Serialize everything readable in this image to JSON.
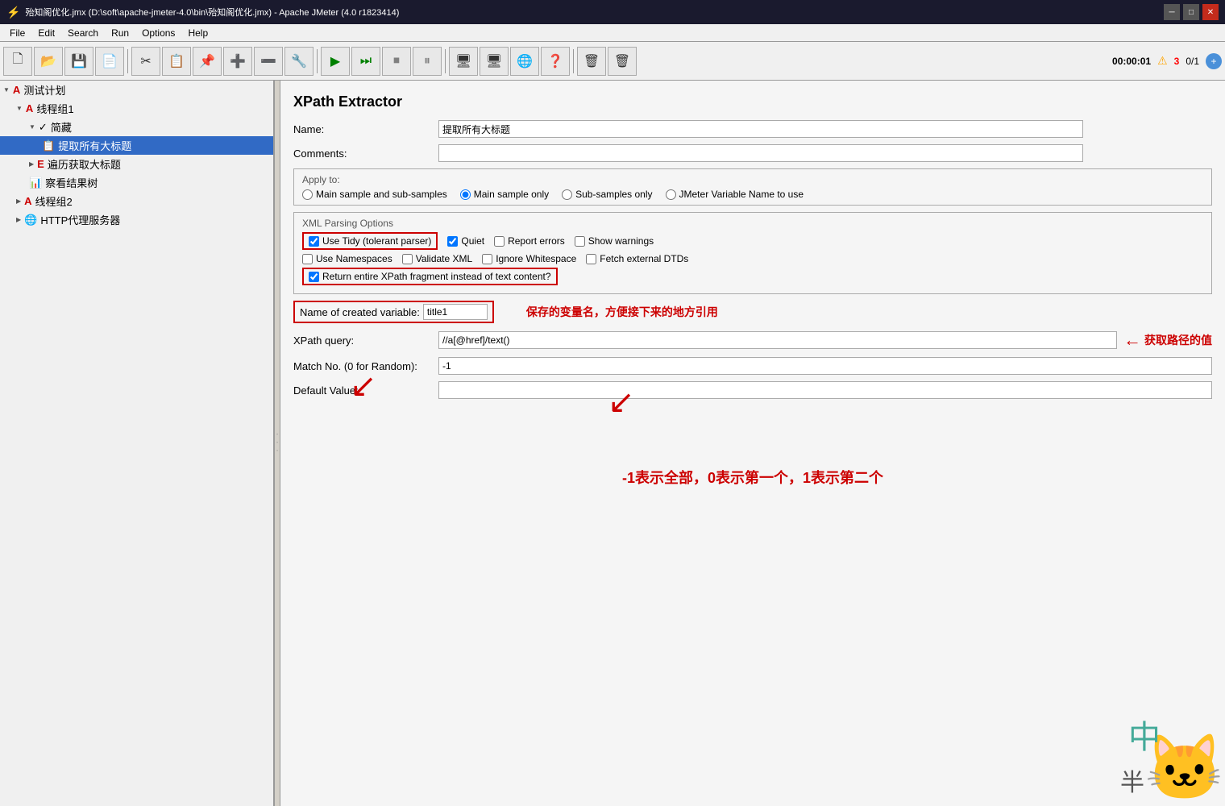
{
  "window": {
    "title": "殆知阁优化.jmx (D:\\soft\\apache-jmeter-4.0\\bin\\殆知阁优化.jmx) - Apache JMeter (4.0 r1823414)",
    "icon": "⚡"
  },
  "title_bar": {
    "minimize": "─",
    "maximize": "□",
    "close": "✕"
  },
  "menu": {
    "items": [
      "File",
      "Edit",
      "Search",
      "Run",
      "Options",
      "Help"
    ]
  },
  "toolbar": {
    "timer": "00:00:01",
    "count": "0/1"
  },
  "sidebar": {
    "items": [
      {
        "id": "test-plan",
        "label": "测试计划",
        "level": 0,
        "icon": "🔧",
        "expand": true,
        "selected": false
      },
      {
        "id": "thread-group1",
        "label": "线程组1",
        "level": 1,
        "icon": "⚙",
        "expand": true,
        "selected": false
      },
      {
        "id": "collection",
        "label": "简藏",
        "level": 2,
        "icon": "📁",
        "expand": true,
        "selected": false
      },
      {
        "id": "extract-title",
        "label": "提取所有大标题",
        "level": 3,
        "icon": "📋",
        "expand": false,
        "selected": true
      },
      {
        "id": "traverse-get",
        "label": "遍历获取大标题",
        "level": 2,
        "icon": "🔄",
        "expand": false,
        "selected": false
      },
      {
        "id": "view-result",
        "label": "察看结果树",
        "level": 2,
        "icon": "📊",
        "expand": false,
        "selected": false
      },
      {
        "id": "thread-group2",
        "label": "线程组2",
        "level": 1,
        "icon": "⚙",
        "expand": false,
        "selected": false
      },
      {
        "id": "http-proxy",
        "label": "HTTP代理服务器",
        "level": 1,
        "icon": "🌐",
        "expand": false,
        "selected": false
      }
    ]
  },
  "panel": {
    "title": "XPath Extractor",
    "name_label": "Name:",
    "name_value": "提取所有大标题",
    "comments_label": "Comments:",
    "comments_value": "",
    "apply_to": {
      "title": "Apply to:",
      "options": [
        {
          "id": "main-sub",
          "label": "Main sample and sub-samples",
          "selected": false
        },
        {
          "id": "main-only",
          "label": "Main sample only",
          "selected": true
        },
        {
          "id": "sub-only",
          "label": "Sub-samples only",
          "selected": false
        },
        {
          "id": "jmeter-var",
          "label": "JMeter Variable Name to use",
          "selected": false
        }
      ]
    },
    "xml_options": {
      "title": "XML Parsing Options",
      "row1": [
        {
          "id": "use-tidy",
          "label": "Use Tidy (tolerant parser)",
          "checked": true
        },
        {
          "id": "quiet",
          "label": "Quiet",
          "checked": true
        },
        {
          "id": "report-errors",
          "label": "Report errors",
          "checked": false
        },
        {
          "id": "show-warnings",
          "label": "Show warnings",
          "checked": false
        }
      ],
      "row2": [
        {
          "id": "use-ns",
          "label": "Use Namespaces",
          "checked": false
        },
        {
          "id": "validate-xml",
          "label": "Validate XML",
          "checked": false
        },
        {
          "id": "ignore-ws",
          "label": "Ignore Whitespace",
          "checked": false
        },
        {
          "id": "fetch-dtds",
          "label": "Fetch external DTDs",
          "checked": false
        }
      ],
      "row3": [
        {
          "id": "return-fragment",
          "label": "Return entire XPath fragment instead of text content?",
          "checked": true
        }
      ]
    },
    "name_of_variable_label": "Name of created variable:",
    "name_of_variable_value": "title1",
    "xpath_query_label": "XPath query:",
    "xpath_query_value": "//a[@href]/text()",
    "match_no_label": "Match No. (0 for Random):",
    "match_no_value": "-1",
    "default_value_label": "Default Value:",
    "default_value": ""
  },
  "annotations": {
    "arrow1": "→",
    "text1": "保存的变量名，方便接下来的地方引用",
    "text2": "获取路径的值",
    "text3": "-1表示全部，0表示第一个，1表示第二个"
  }
}
